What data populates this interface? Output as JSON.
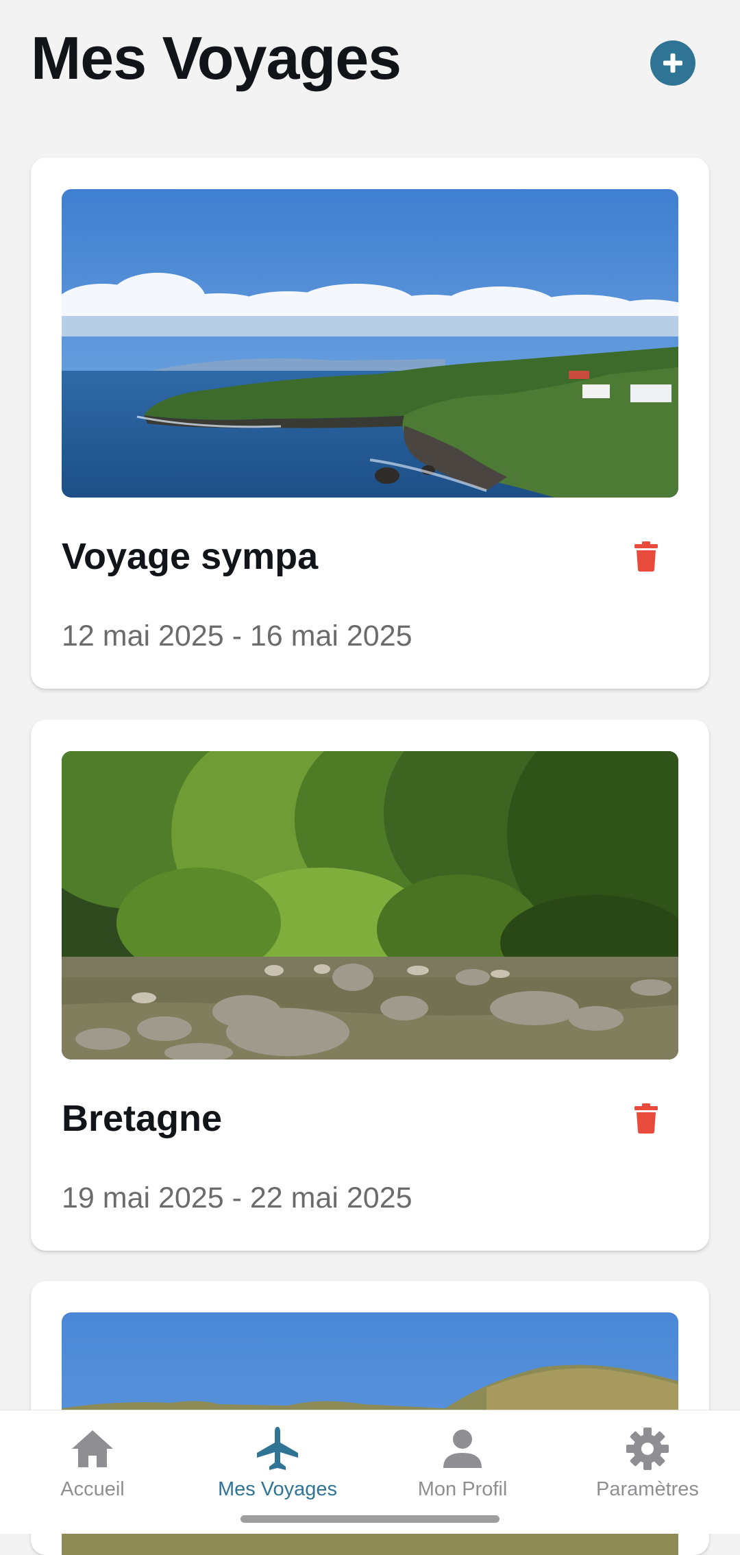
{
  "header": {
    "title": "Mes Voyages",
    "add_icon": "plus-circle-icon",
    "accent_color": "#2f7495"
  },
  "trips": [
    {
      "title": "Voyage sympa",
      "dates": "12 mai 2025 - 16 mai 2025",
      "image": "coastal-cliffs-photo",
      "delete_icon": "trash-icon"
    },
    {
      "title": "Bretagne",
      "dates": "19 mai 2025 - 22 mai 2025",
      "image": "jungle-river-photo",
      "delete_icon": "trash-icon"
    },
    {
      "image": "hills-sky-photo"
    }
  ],
  "colors": {
    "delete": "#e84b3c",
    "title_text": "#111418",
    "secondary_text": "#6b6b6b",
    "tab_inactive": "#8e8e93",
    "tab_active": "#2f7495"
  },
  "tabs": [
    {
      "label": "Accueil",
      "icon": "home-icon",
      "active": false
    },
    {
      "label": "Mes Voyages",
      "icon": "airplane-icon",
      "active": true
    },
    {
      "label": "Mon Profil",
      "icon": "person-icon",
      "active": false
    },
    {
      "label": "Paramètres",
      "icon": "gear-icon",
      "active": false
    }
  ]
}
